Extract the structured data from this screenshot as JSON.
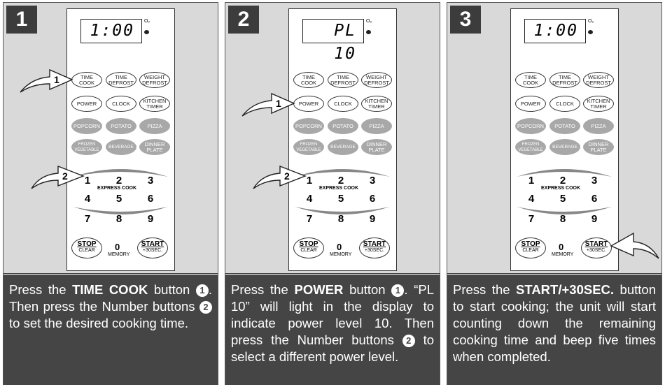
{
  "panels": [
    {
      "step": "1",
      "display": "1:00",
      "pointers": [
        "1",
        "2"
      ],
      "caption": {
        "pre": "Press the ",
        "bold": "TIME COOK",
        "mid": " button ",
        "c1": "1",
        "mid2": ". Then press the Number buttons ",
        "c2": "2",
        "post": " to set the desired cooking time."
      }
    },
    {
      "step": "2",
      "display": "PL 10",
      "pointers": [
        "1",
        "2"
      ],
      "caption": {
        "pre": "Press the ",
        "bold": "POWER",
        "mid": " button ",
        "c1": "1",
        "mid2": ". “PL 10” will light in the display to indicate power level 10. Then press the Number buttons ",
        "c2": "2",
        "post": " to select a different power level."
      }
    },
    {
      "step": "3",
      "display": "1:00",
      "pointers": [],
      "caption": {
        "pre": "Press the ",
        "bold": "START/+30SEC.",
        "mid": " button to start cooking; the unit will start counting down the remaining cooking time and beep five times when completed.",
        "c1": "",
        "mid2": "",
        "c2": "",
        "post": ""
      }
    }
  ],
  "keypad": {
    "o2": "O₂",
    "time_cook": "TIME\nCOOK",
    "time_defrost": "TIME\nDEFROST",
    "weight_defrost": "WEIGHT\nDEFROST",
    "power": "POWER",
    "clock": "CLOCK",
    "kitchen_timer": "KITCHEN\nTIMER",
    "popcorn": "POPCORN",
    "potato": "POTATO",
    "pizza": "PIZZA",
    "frozen_vegetable": "FROZEN\nVEGETABLE",
    "beverage": "BEVERAGE",
    "dinner_plate": "DINNER\nPLATE",
    "express_cook": "EXPRESS COOK",
    "numbers": [
      "1",
      "2",
      "3",
      "4",
      "5",
      "6",
      "7",
      "8",
      "9"
    ],
    "zero": "0",
    "memory": "MEMORY",
    "stop": "STOP",
    "clear": "CLEAR",
    "start": "START",
    "plus30": "+30SEC."
  },
  "colors": {
    "caption_bg": "#454545",
    "panel_bg": "#d9d9d9",
    "special_key": "#a8a8a8"
  }
}
